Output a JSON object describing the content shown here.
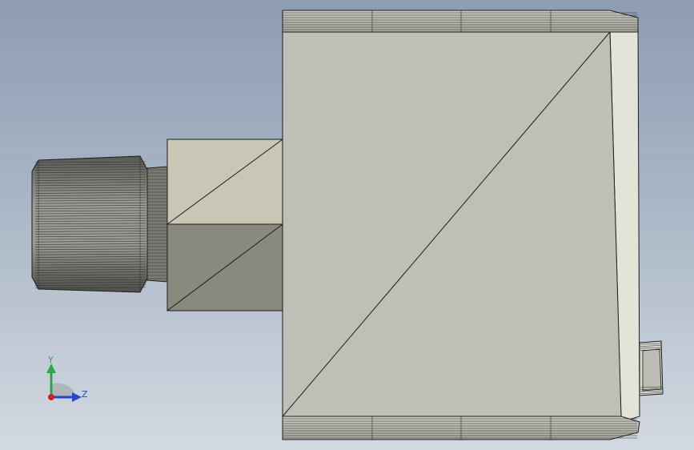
{
  "viewport": {
    "background_top": "#8e9cb3",
    "background_bottom": "#d2d9e1"
  },
  "model": {
    "body_face_color": "#bfbfb6",
    "neck_face_color": "#c8c6b4",
    "neck_shadow_color": "#8a897d",
    "knob_color": "#8a8a84",
    "side_face_color": "#e4e3d8",
    "edge_color": "#1c1c1c"
  },
  "triad": {
    "y_label": "Y",
    "z_label": "Z",
    "y_color": "#2da64a",
    "z_color": "#2448c8",
    "origin_color": "#d62020"
  }
}
